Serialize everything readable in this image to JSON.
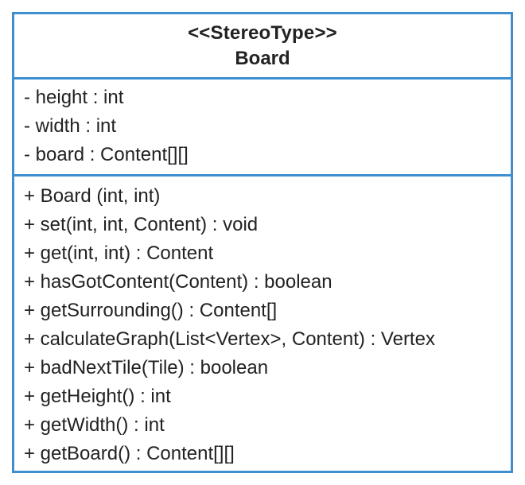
{
  "class_box": {
    "stereotype": "<<StereoType>>",
    "name": "Board",
    "attributes": [
      "- height : int",
      "- width : int",
      "- board : Content[][]"
    ],
    "operations": [
      "+ Board (int, int)",
      "+ set(int, int, Content) : void",
      "+ get(int, int) : Content",
      "+ hasGotContent(Content) : boolean",
      "+ getSurrounding() : Content[]",
      "+ calculateGraph(List<Vertex>, Content) : Vertex",
      "+ badNextTile(Tile) : boolean",
      "+ getHeight() : int",
      "+ getWidth() : int",
      "+ getBoard() : Content[][]"
    ]
  },
  "colors": {
    "border": "#3d8fd0",
    "text": "#222222",
    "background": "#ffffff"
  }
}
